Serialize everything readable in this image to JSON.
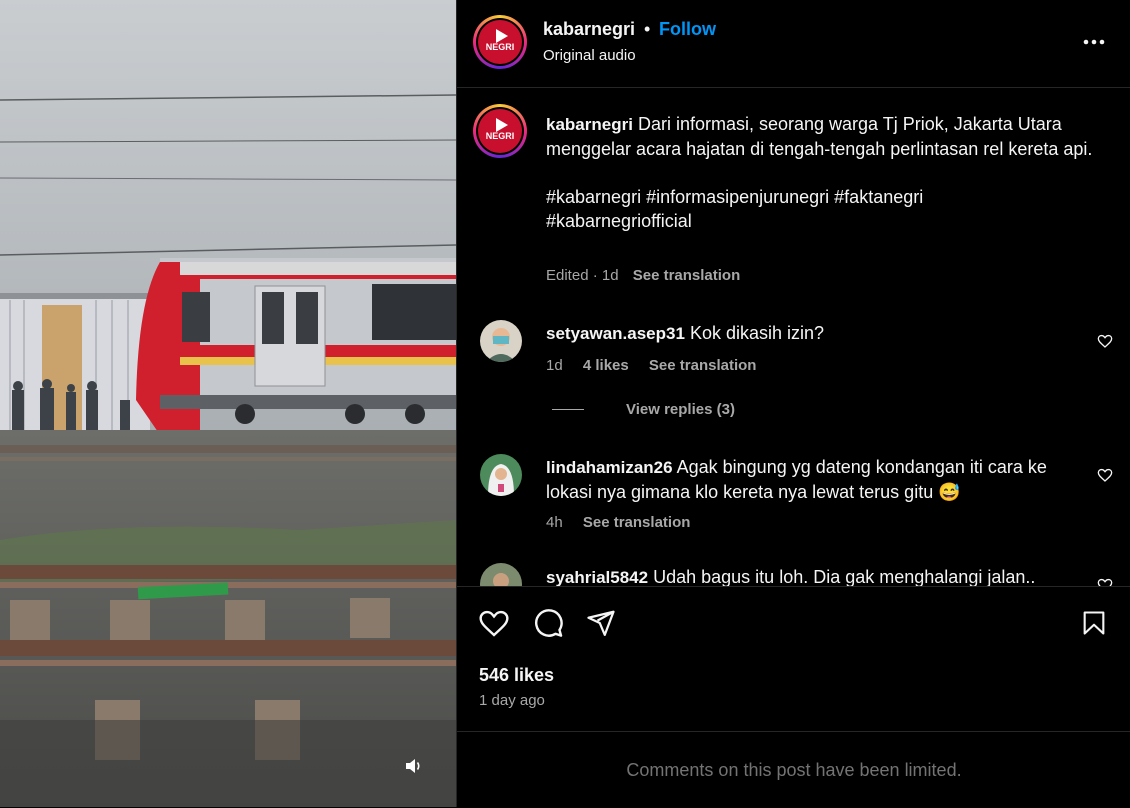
{
  "post": {
    "username": "kabarnegri",
    "dot": "•",
    "follow_label": "Follow",
    "audio": "Original audio",
    "avatar_text": "NEGRI"
  },
  "caption": {
    "username": "kabarnegri",
    "text": "Dari informasi, seorang warga Tj Priok, Jakarta Utara menggelar acara hajatan di tengah-tengah perlintasan rel kereta api.",
    "hashtags_1": "#kabarnegri #informasipenjurunegri #faktanegri",
    "hashtags_2": "#kabarnegriofficial",
    "meta_edited": "Edited · 1d",
    "meta_translate": "See translation"
  },
  "comments": [
    {
      "username": "setyawan.asep31",
      "text": "Kok dikasih izin?",
      "time": "1d",
      "likes": "4 likes",
      "translate": "See translation",
      "replies": "View replies (3)"
    },
    {
      "username": "lindahamizan26",
      "text": "Agak bingung yg dateng kondangan iti cara ke lokasi nya gimana klo kereta nya lewat terus gitu",
      "emoji": "😅",
      "time": "4h",
      "translate": "See translation"
    },
    {
      "username": "syahrial5842",
      "text": "Udah bagus itu loh. Dia gak menghalangi jalan.."
    }
  ],
  "actions": {
    "likes": "546 likes",
    "time": "1 day ago"
  },
  "footer": {
    "limited": "Comments on this post have been limited."
  },
  "icons": {
    "more": "more-icon",
    "like": "heart-icon",
    "comment": "comment-icon",
    "share": "share-icon",
    "save": "bookmark-icon",
    "mute": "speaker-icon"
  },
  "colors": {
    "accent": "#0095f6",
    "background": "#000000",
    "secondary_text": "#a8a8a8",
    "muted_text": "#737373",
    "divider": "#262626"
  }
}
